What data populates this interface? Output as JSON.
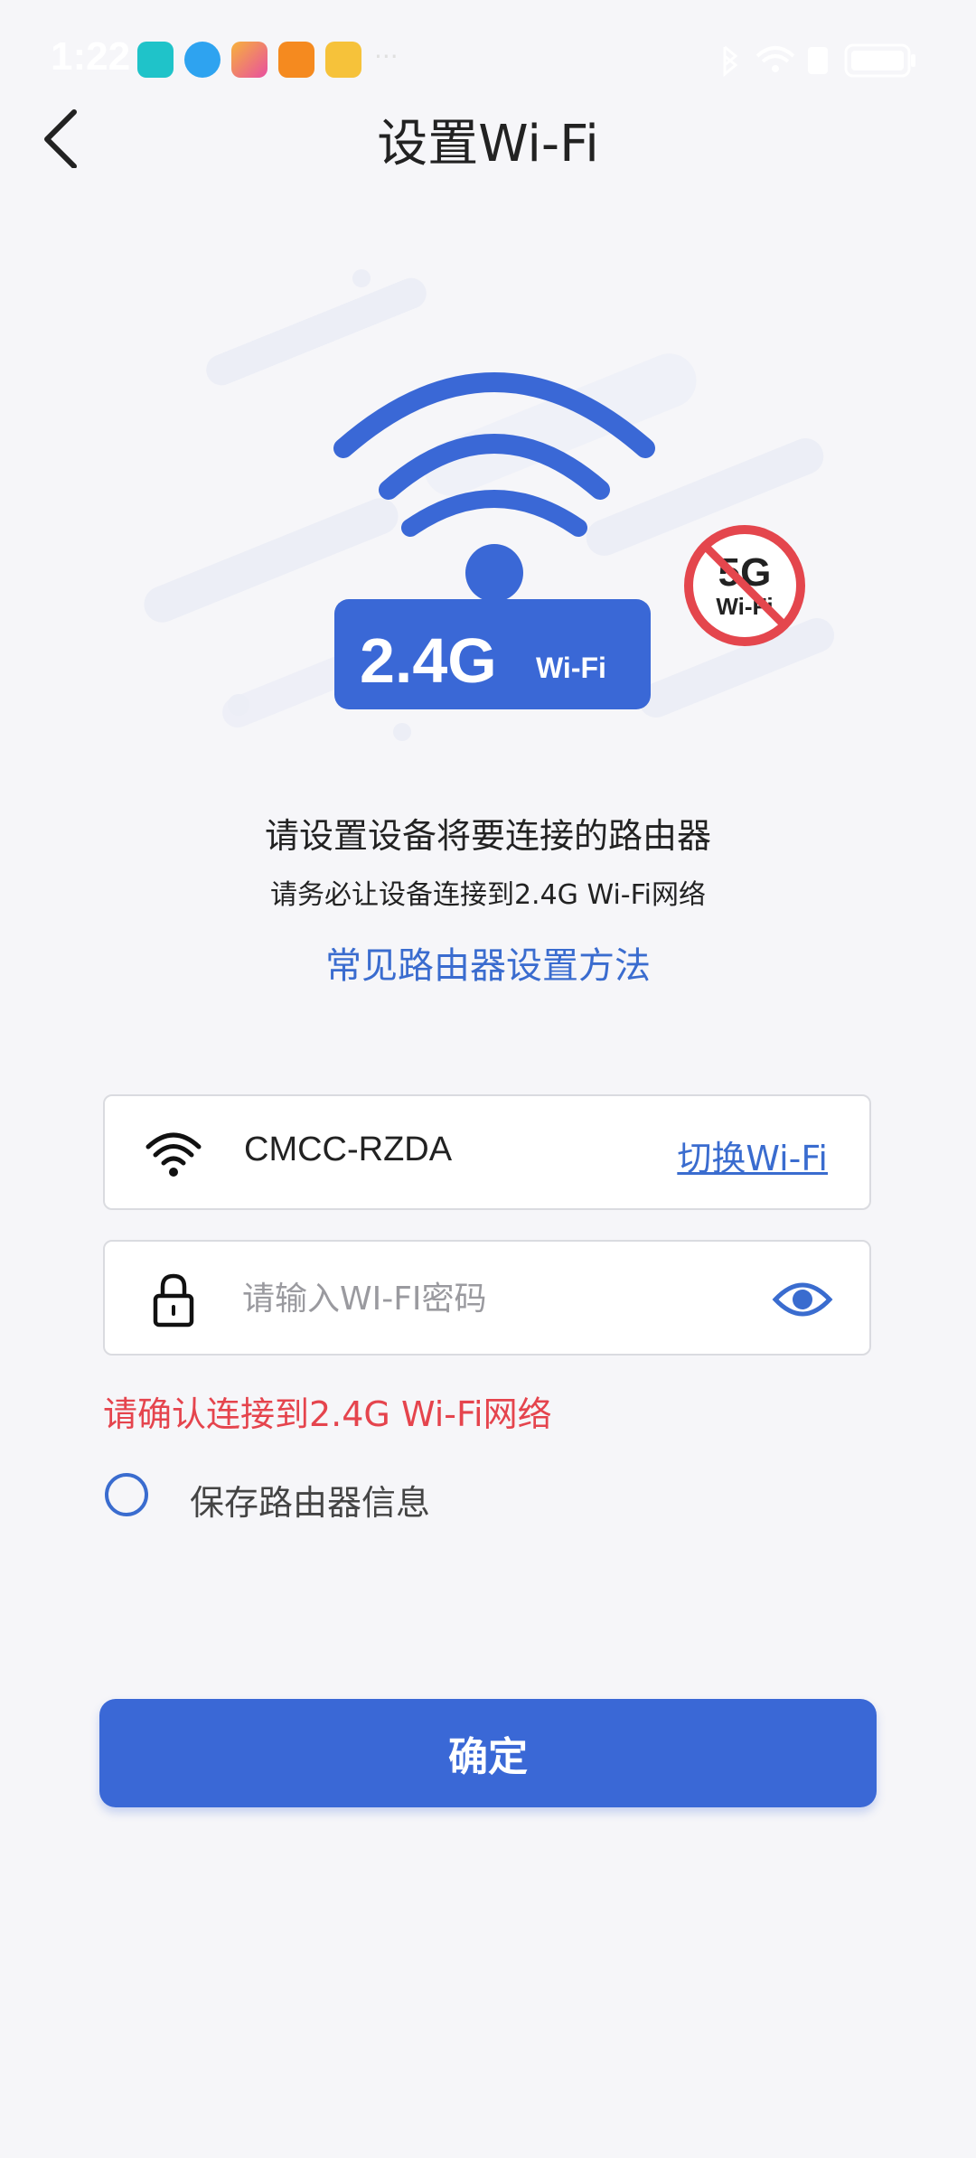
{
  "status_bar": {
    "time": "1:22",
    "more": "···"
  },
  "header": {
    "title": "设置Wi-Fi"
  },
  "illustration": {
    "band_label": "2.4G",
    "band_suffix": "Wi-Fi",
    "forbidden_band": "5G",
    "forbidden_suffix": "Wi-Fi"
  },
  "intro": {
    "main": "请设置设备将要连接的路由器",
    "sub": "请务必让设备连接到2.4G Wi-Fi网络",
    "help_link": "常见路由器设置方法"
  },
  "wifi_field": {
    "ssid": "CMCC-RZDA",
    "switch_label": "切换Wi-Fi"
  },
  "password_field": {
    "value": "",
    "placeholder": "请输入WI-FI密码"
  },
  "warning": "请确认连接到2.4G Wi-Fi网络",
  "save_option": {
    "label": "保存路由器信息",
    "checked": false
  },
  "confirm_button": "确定",
  "colors": {
    "accent": "#3a6ccf",
    "button": "#3a68d6",
    "warning": "#e5444d",
    "background": "#f6f6f9"
  }
}
